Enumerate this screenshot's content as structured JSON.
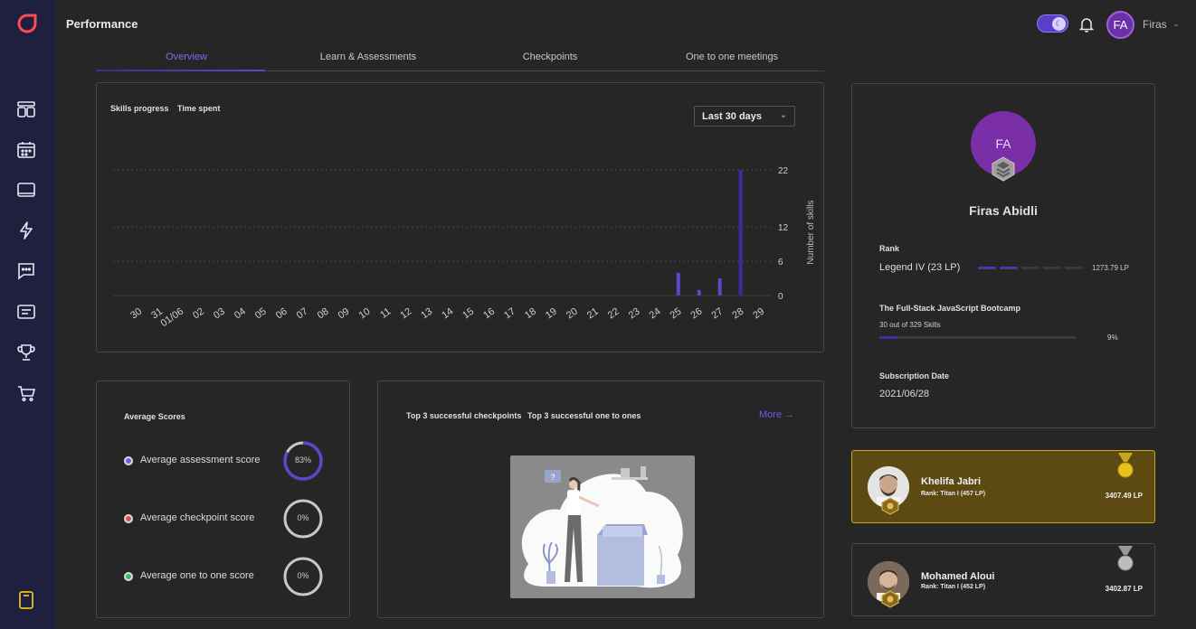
{
  "header": {
    "title": "Performance",
    "user_initials": "FA",
    "user_name": "Firas"
  },
  "tabs": [
    {
      "label": "Overview",
      "active": true
    },
    {
      "label": "Learn & Assessments",
      "active": false
    },
    {
      "label": "Checkpoints",
      "active": false
    },
    {
      "label": "One to one meetings",
      "active": false
    }
  ],
  "sidebar": {
    "items": [
      "dashboard-icon",
      "calendar-icon",
      "laptop-icon",
      "lightning-icon",
      "chat-icon",
      "news-icon",
      "trophy-icon",
      "cart-icon",
      "notebook-icon"
    ]
  },
  "progress_card": {
    "tab_skills": "Skills progress",
    "tab_time": "Time spent",
    "period": "Last 30 days"
  },
  "chart_data": {
    "type": "bar",
    "categories": [
      "30",
      "31",
      "01/06",
      "02",
      "03",
      "04",
      "05",
      "06",
      "07",
      "08",
      "09",
      "10",
      "11",
      "12",
      "13",
      "14",
      "15",
      "16",
      "17",
      "18",
      "19",
      "20",
      "21",
      "22",
      "23",
      "24",
      "25",
      "26",
      "27",
      "28",
      "29"
    ],
    "values": [
      0,
      0,
      0,
      0,
      0,
      0,
      0,
      0,
      0,
      0,
      0,
      0,
      0,
      0,
      0,
      0,
      0,
      0,
      0,
      0,
      0,
      0,
      0,
      0,
      0,
      0,
      4,
      1,
      3,
      22,
      0
    ],
    "ylabel": "Number of skills",
    "yticks": [
      0,
      6,
      12,
      22
    ],
    "ylim": [
      0,
      22
    ],
    "grid": true,
    "bar_color": "#5b48c9",
    "peak_color": "#3a2ba3"
  },
  "scores": {
    "title": "Average Scores",
    "items": [
      {
        "label": "Average assessment score",
        "value": "83%",
        "fraction": 0.83,
        "dot_color": "#6b5cf0"
      },
      {
        "label": "Average checkpoint score",
        "value": "0%",
        "fraction": 0,
        "dot_color": "#e0504b"
      },
      {
        "label": "Average one to one score",
        "value": "0%",
        "fraction": 0,
        "dot_color": "#2fbf70"
      }
    ]
  },
  "top_card": {
    "tab_checkpoints": "Top 3 successful checkpoints",
    "tab_one_to_ones": "Top 3 successful one to ones",
    "more": "More"
  },
  "profile": {
    "initials": "FA",
    "name": "Firas Abidli",
    "rank_label": "Rank",
    "rank_value": "Legend IV (23 LP)",
    "rank_lp": "1273.79 LP",
    "rank_segments_on": 2,
    "rank_segments_total": 5,
    "course_label": "The Full-Stack JavaScript Bootcamp",
    "course_progress_text": "30 out of 329 Skills",
    "course_percent": "9%",
    "course_fraction": 0.09,
    "subscription_label": "Subscription Date",
    "subscription_date": "2021/06/28"
  },
  "leaderboard": [
    {
      "name": "Khelifa Jabri",
      "rank": "Rank: Titan I (457 LP)",
      "lp": "3407.49 LP",
      "medal": "gold",
      "bg": "#5c4a12",
      "border": "#c9a520"
    },
    {
      "name": "Mohamed Aloui",
      "rank": "Rank: Titan I (452 LP)",
      "lp": "3402.87 LP",
      "medal": "silver",
      "bg": "#262626",
      "border": "#474747"
    }
  ]
}
